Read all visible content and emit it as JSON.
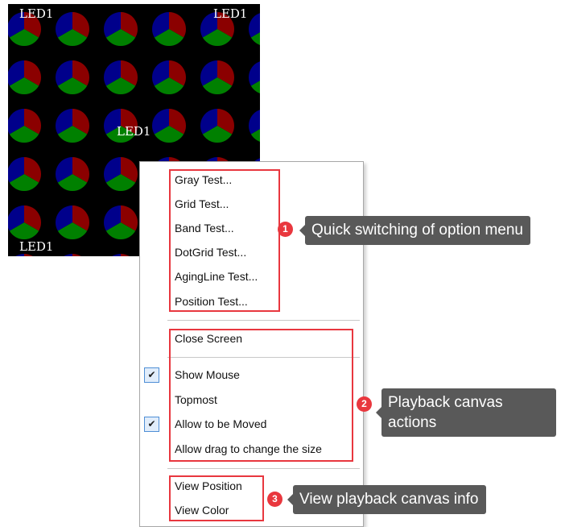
{
  "canvas": {
    "led_labels": [
      "LED1",
      "LED1",
      "LED1",
      "LED1"
    ],
    "colors": {
      "red": "#8b0000",
      "green": "#008000",
      "blue": "#00008b",
      "background": "#000000"
    }
  },
  "menu": {
    "group1": [
      "Gray Test...",
      "Grid Test...",
      "Band Test...",
      "DotGrid Test...",
      "AgingLine Test...",
      "Position Test..."
    ],
    "close_screen": "Close Screen",
    "show_mouse": {
      "label": "Show Mouse",
      "checked": true
    },
    "topmost": {
      "label": "Topmost",
      "checked": false
    },
    "allow_moved": {
      "label": "Allow to be Moved",
      "checked": true
    },
    "allow_drag": {
      "label": "Allow drag to change the size",
      "checked": false
    },
    "view_position": "View Position",
    "view_color": "View Color",
    "check_glyph": "✔"
  },
  "callouts": [
    {
      "num": "1",
      "text": "Quick switching of option menu"
    },
    {
      "num": "2",
      "text": "Playback canvas\nactions"
    },
    {
      "num": "3",
      "text": "View playback canvas info"
    }
  ],
  "accent": {
    "highlight": "#e8373f",
    "callout_bg": "#595959"
  }
}
